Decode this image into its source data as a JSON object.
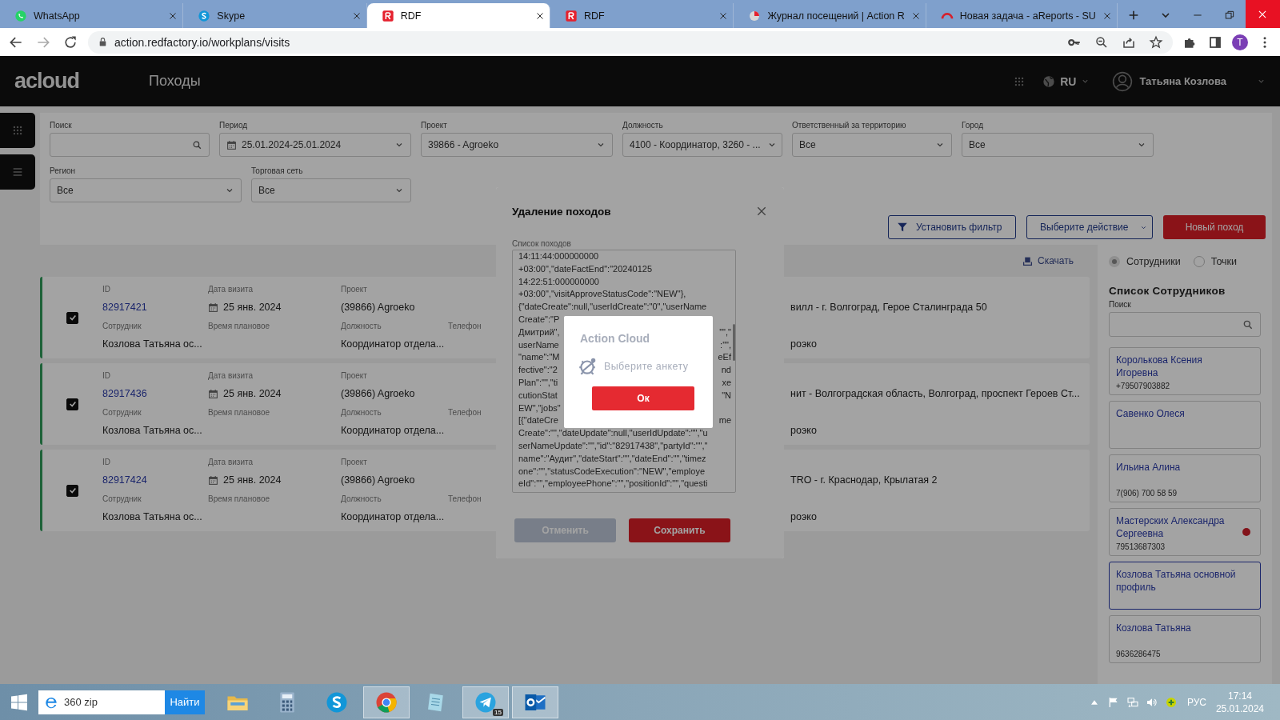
{
  "browser": {
    "tabs": [
      {
        "title": "WhatsApp",
        "kind": "chat",
        "selected": false
      },
      {
        "title": "Skype",
        "kind": "call",
        "selected": false
      },
      {
        "title": "RDF",
        "kind": "app",
        "selected": true
      },
      {
        "title": "RDF",
        "kind": "app",
        "selected": false
      },
      {
        "title": "Журнал посещений | Action R",
        "kind": "report",
        "selected": false
      },
      {
        "title": "Новая задача - aReports - SU",
        "kind": "gauge",
        "selected": false
      }
    ],
    "url": "action.redfactory.io/workplans/visits",
    "profile": "T"
  },
  "header": {
    "logo": "acloud",
    "title": "Походы",
    "language": "RU",
    "user": "Татьяна Козлова"
  },
  "filters": [
    {
      "label": "Поиск",
      "kind": "search"
    },
    {
      "label": "Период",
      "kind": "date",
      "value": "25.01.2024-25.01.2024"
    },
    {
      "label": "Проект",
      "kind": "select",
      "value": "39866 - Agroeko"
    },
    {
      "label": "Должность",
      "kind": "select",
      "value": "4100 - Координатор, 3260 - ..."
    },
    {
      "label": "Ответственный за территорию",
      "kind": "select",
      "value": "Все"
    },
    {
      "label": "Город",
      "kind": "select",
      "value": "Все"
    },
    {
      "label": "Регион",
      "kind": "select",
      "value": "Все"
    },
    {
      "label": "Торговая сеть",
      "kind": "select",
      "value": "Все"
    }
  ],
  "actions": [
    {
      "label": "Установить фильтр",
      "kind": "filter"
    },
    {
      "label": "Выберите действие",
      "kind": "dropdown"
    },
    {
      "label": "Новый поход",
      "kind": "primary"
    }
  ],
  "download": "Скачать",
  "visits": [
    {
      "checked": true,
      "id_label": "ID",
      "id": "82917421",
      "date_label": "Дата визита",
      "date": "25 янв. 2024",
      "project_label": "Проект",
      "project": "(39866) Agroeko",
      "employee_label": "Сотрудник",
      "employee": "Козлова Татьяна ос...",
      "planned_label": "Время плановое",
      "position_label": "Должность",
      "position": "Координатор отдела...",
      "phone_label": "Телефон",
      "column_5": "вилл - г. Волгоград, Герое Сталинграда 50",
      "column_6": "роэко"
    },
    {
      "checked": true,
      "id_label": "ID",
      "id": "82917436",
      "date_label": "Дата визита",
      "date": "25 янв. 2024",
      "project_label": "Проект",
      "project": "(39866) Agroeko",
      "employee_label": "Сотрудник",
      "employee": "Козлова Татьяна ос...",
      "planned_label": "Время плановое",
      "position_label": "Должность",
      "position": "Координатор отдела...",
      "phone_label": "Телефон",
      "column_5": "нит - Волгоградская область, Волгоград, проспект Героев Ст...",
      "column_6": "роэко"
    },
    {
      "checked": true,
      "id_label": "ID",
      "id": "82917424",
      "date_label": "Дата визита",
      "date": "25 янв. 2024",
      "project_label": "Проект",
      "project": "(39866) Agroeko",
      "employee_label": "Сотрудник",
      "employee": "Козлова Татьяна ос...",
      "planned_label": "Время плановое",
      "position_label": "Должность",
      "position": "Координатор отдела...",
      "phone_label": "Телефон",
      "column_5": "TRO - г. Краснодар, Крылатая 2",
      "column_6": "роэко"
    }
  ],
  "side_panel": {
    "modes": [
      {
        "label": "Сотрудники",
        "selected": true
      },
      {
        "label": "Точки",
        "selected": false
      }
    ],
    "title": "Список Сотрудников",
    "search_label": "Поиск",
    "employees": [
      {
        "name": "Королькова Ксения Игоревна",
        "phone": "+79507903882",
        "selected": false,
        "flagged": false
      },
      {
        "name": "Савенко Олеся",
        "selected": false,
        "flagged": false
      },
      {
        "name": "Ильина Алина",
        "phone": "7(906) 700 58 59",
        "selected": false,
        "flagged": false
      },
      {
        "name": "Мастерских Александра Сергеевна",
        "phone": "79513687303",
        "selected": false,
        "flagged": true
      },
      {
        "name": "Козлова Татьяна основной профиль",
        "selected": true,
        "flagged": false
      },
      {
        "name": "Козлова Татьяна",
        "phone": "9636286475",
        "selected": false,
        "flagged": false
      }
    ]
  },
  "modal": {
    "title": "Удаление походов",
    "field_label": "Список походов",
    "lines": [
      {
        "left": "14:11:44:000000000"
      },
      {
        "left": "+03:00\",\"dateFactEnd\":\"20240125"
      },
      {
        "left": "14:22:51:000000000"
      },
      {
        "left": "+03:00\",\"visitApproveStatusCode\":\"NEW\"},"
      },
      {
        "left": "{\"dateCreate\":null,\"userIdCreate\":\"0\",\"userName"
      },
      {
        "left": "Create\":\"Р"
      },
      {
        "left": "Дмитрий\",",
        "right": "\"\",\""
      },
      {
        "left": "userName",
        "right": ":\"\","
      },
      {
        "left": "\"name\":\"М",
        "right": "eEf"
      },
      {
        "left": "fective\":\"2",
        "right": "nd"
      },
      {
        "left": "Plan\":\"\",\"ti",
        "right": "xe"
      },
      {
        "left": "cutionStat",
        "right": "\"N"
      },
      {
        "left": "EW\",\"jobs\""
      },
      {
        "left": "[{\"dateCre",
        "right": "me"
      },
      {
        "left": "Create\":\"\",\"dateUpdate\":null,\"userIdUpdate\":\"\",\"u"
      },
      {
        "left": "serNameUpdate\":\"\",\"id\":\"82917438\",\"partyId\":\"\",\""
      },
      {
        "left": "name\":\"Аудит\",\"dateStart\":\"\",\"dateEnd\":\"\",\"timez"
      },
      {
        "left": "one\":\"\",\"statusCodeExecution\":\"NEW\",\"employe"
      },
      {
        "left": "eId\":\"\",\"employeePhone\":\"\",\"positionId\":\"\",\"questi"
      }
    ],
    "buttons": [
      {
        "label": "Отменить",
        "kind": "secondary"
      },
      {
        "label": "Сохранить",
        "kind": "primary"
      }
    ]
  },
  "alert": {
    "title": "Action Cloud",
    "message": "Выберите анкету",
    "button": "Ок"
  },
  "taskbar": {
    "search": "360 zip",
    "search_button": "Найти",
    "apps": [
      {
        "kind": "folder",
        "active": false
      },
      {
        "kind": "calculator",
        "active": false
      },
      {
        "kind": "call",
        "active": false
      },
      {
        "kind": "browser",
        "active": true
      },
      {
        "kind": "notepad",
        "active": false
      },
      {
        "kind": "messenger",
        "active": true,
        "badge": "15"
      },
      {
        "kind": "mail",
        "active": true
      }
    ],
    "language": "РУС",
    "time": "17:14",
    "date": "25.01.2024"
  }
}
